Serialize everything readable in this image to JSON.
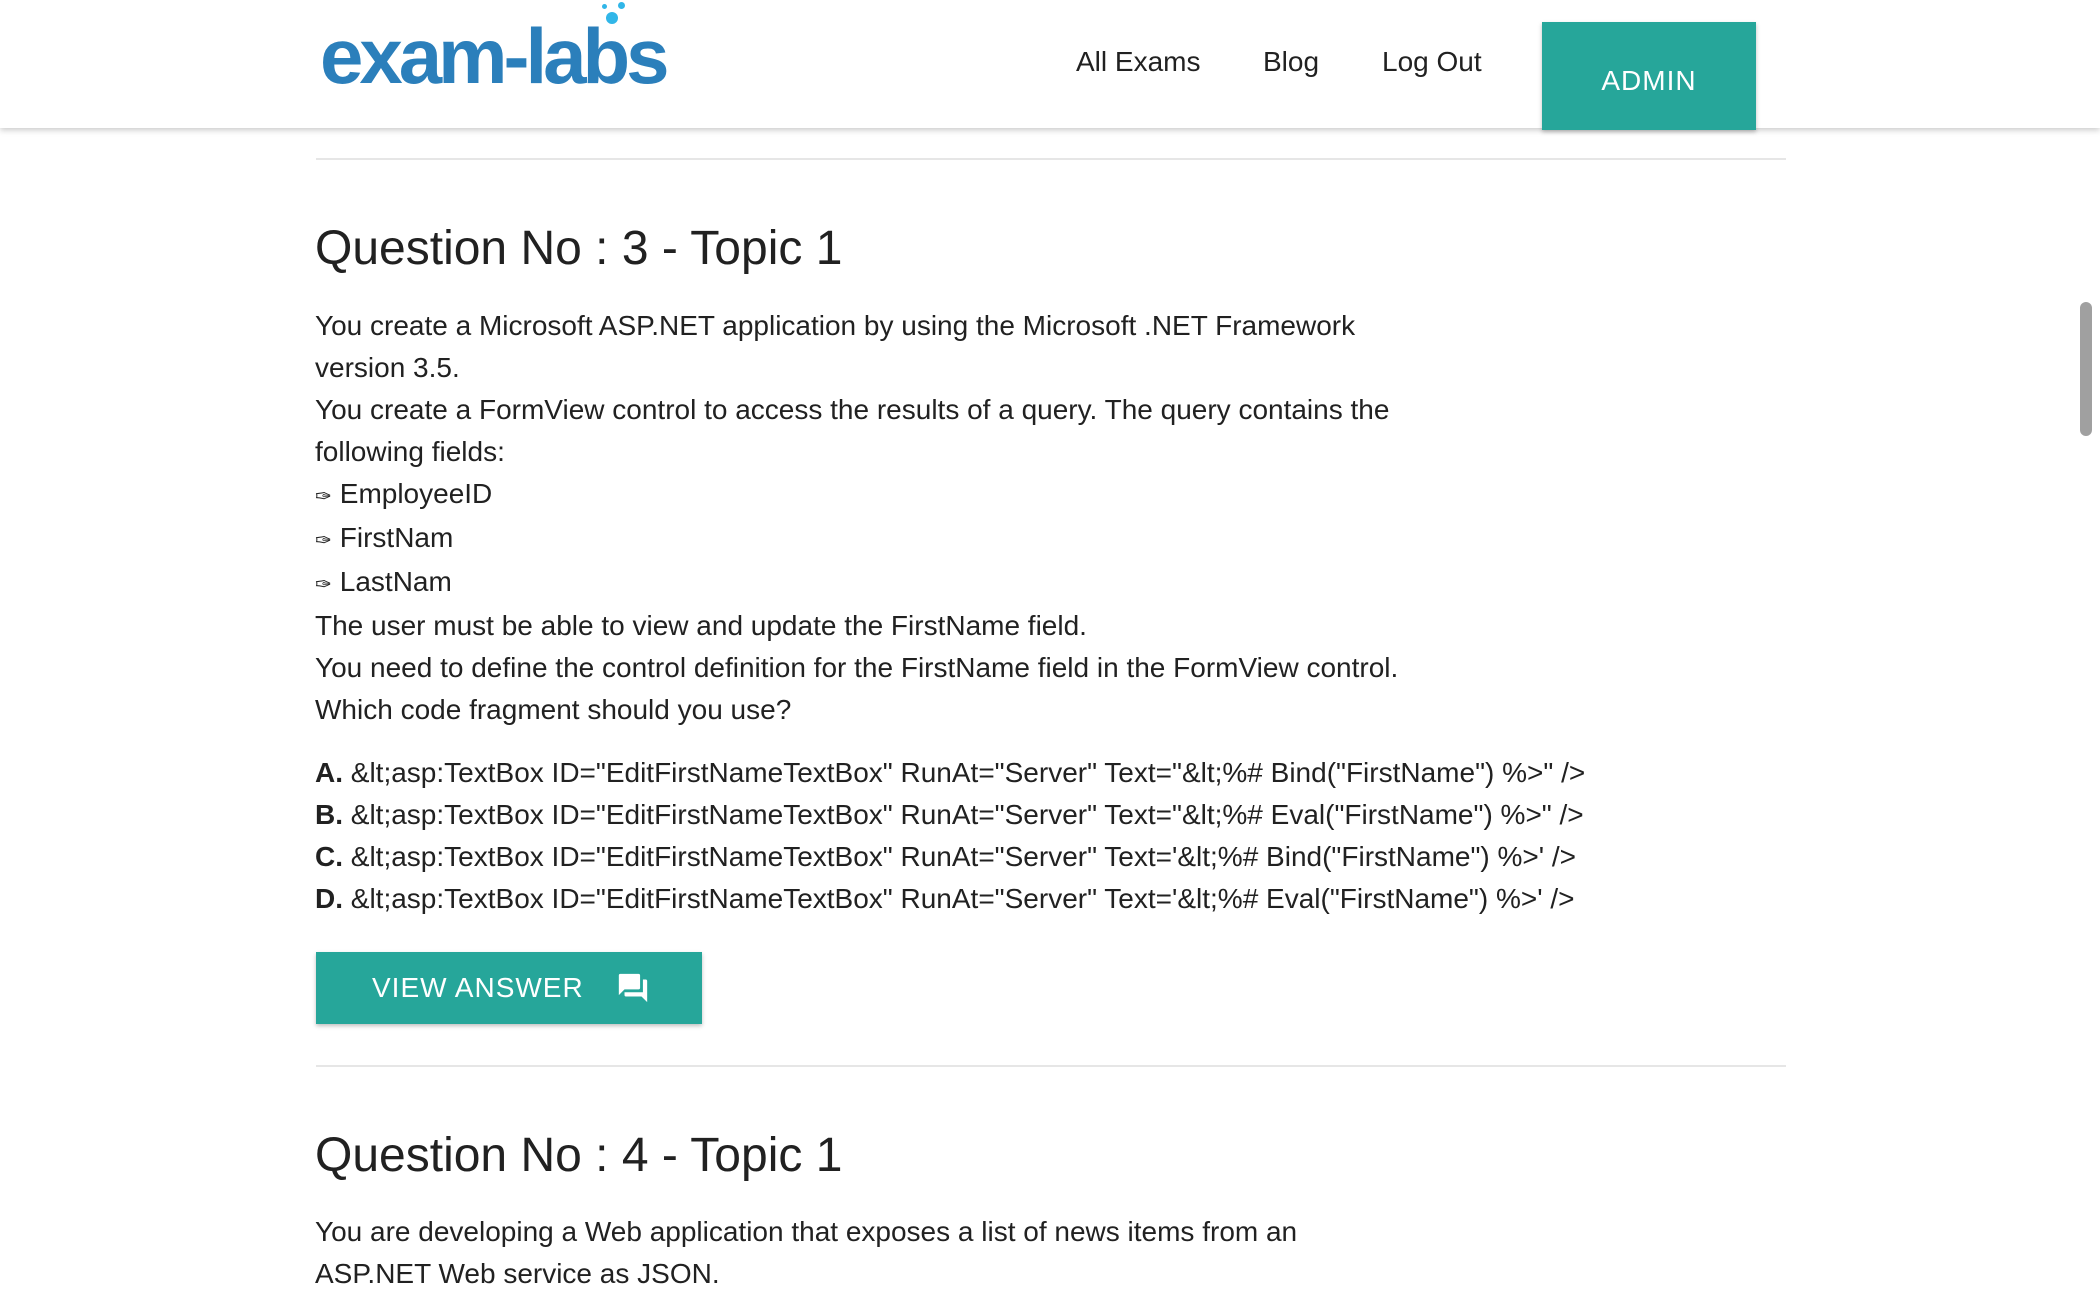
{
  "header": {
    "logo_text": "exam-labs",
    "nav": [
      "All Exams",
      "Blog",
      "Log Out"
    ],
    "admin_label": "ADMIN",
    "accent": "#26a69a"
  },
  "questions": [
    {
      "title": "Question No : 3 - Topic 1",
      "lines": [
        "You create a Microsoft ASP.NET application by using the Microsoft .NET Framework",
        "version 3.5.",
        "You create a FormView control to access the results of a query. The query contains the",
        "following fields:"
      ],
      "fields": [
        "EmployeeID",
        "FirstNam",
        "LastNam"
      ],
      "bullet_glyph": "✑",
      "after_lines": [
        "The user must be able to view and update the FirstName field.",
        "You need to define the control definition for the FirstName field in the FormView control.",
        "Which code fragment should you use?"
      ],
      "options": [
        {
          "letter": "A.",
          "text": "&lt;asp:TextBox ID=\"EditFirstNameTextBox\" RunAt=\"Server\" Text=\"&lt;%# Bind(\"FirstName\") %>\" />"
        },
        {
          "letter": "B.",
          "text": "&lt;asp:TextBox ID=\"EditFirstNameTextBox\" RunAt=\"Server\" Text=\"&lt;%# Eval(\"FirstName\") %>\" />"
        },
        {
          "letter": "C.",
          "text": "&lt;asp:TextBox ID=\"EditFirstNameTextBox\" RunAt=\"Server\" Text='&lt;%# Bind(\"FirstName\") %>' />"
        },
        {
          "letter": "D.",
          "text": "&lt;asp:TextBox ID=\"EditFirstNameTextBox\" RunAt=\"Server\" Text='&lt;%# Eval(\"FirstName\") %>' />"
        }
      ],
      "view_answer_label": "VIEW ANSWER",
      "view_answer_icon": "chat-icon"
    },
    {
      "title": "Question No : 4 - Topic 1",
      "lines": [
        "You are developing a Web application that exposes a list of news items from an",
        "ASP.NET Web service as JSON."
      ]
    }
  ]
}
